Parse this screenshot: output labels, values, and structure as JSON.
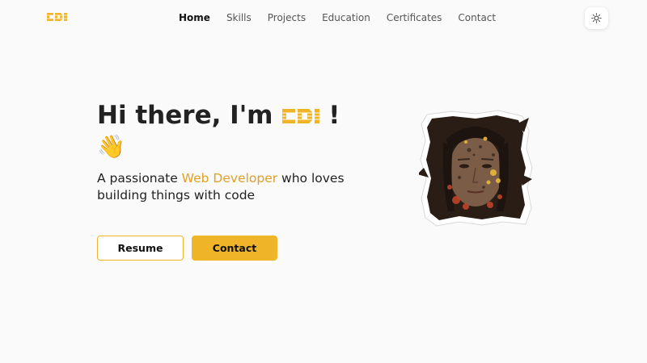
{
  "brand": {
    "logo_text": "CDI",
    "accent_color": "#f0b429",
    "highlight_color": "#e0a024"
  },
  "nav": {
    "items": [
      {
        "label": "Home",
        "active": true
      },
      {
        "label": "Skills",
        "active": false
      },
      {
        "label": "Projects",
        "active": false
      },
      {
        "label": "Education",
        "active": false
      },
      {
        "label": "Certificates",
        "active": false
      },
      {
        "label": "Contact",
        "active": false
      }
    ],
    "theme_toggle_icon": "sun-icon"
  },
  "hero": {
    "greeting_prefix": "Hi there, I'm ",
    "greeting_suffix": "!",
    "wave_emoji": "👋",
    "subtitle_prefix": "A passionate ",
    "subtitle_highlight": "Web Developer",
    "subtitle_suffix": " who loves building things with code",
    "resume_label": "Resume",
    "contact_label": "Contact"
  }
}
